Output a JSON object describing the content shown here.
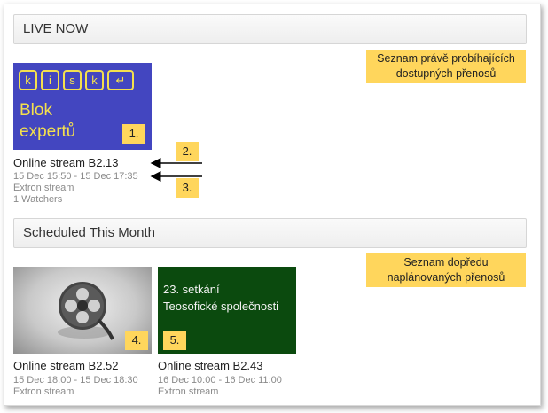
{
  "live": {
    "header": "LIVE NOW",
    "note": [
      "Seznam právě probíhajících",
      "dostupných přenosů"
    ],
    "item": {
      "thumb_keys": [
        "k",
        "i",
        "s",
        "k",
        "↵"
      ],
      "thumb_text": [
        "Blok",
        "expertů"
      ],
      "badge": "1.",
      "title": "Online stream B2.13",
      "time": "15 Dec 15:50 - 15 Dec 17:35",
      "source": "Extron stream",
      "watchers": "1 Watchers"
    },
    "arrow_labels": [
      "2.",
      "3."
    ]
  },
  "scheduled": {
    "header": "Scheduled This Month",
    "note": [
      "Seznam dopředu",
      "naplánovaných přenosů"
    ],
    "items": [
      {
        "badge": "4.",
        "title": "Online stream B2.52",
        "time": "15 Dec 18:00 - 15 Dec 18:30",
        "source": "Extron stream",
        "thumb_icon": "film-reel-icon"
      },
      {
        "badge": "5.",
        "title": "Online stream B2.43",
        "time": "16 Dec 10:00 - 16 Dec 11:00",
        "source": "Extron stream",
        "thumb_text": [
          "23. setkání",
          "Teosofické společnosti"
        ]
      }
    ]
  },
  "colors": {
    "accent_yellow": "#ffd65c",
    "kisk_blue": "#4346c0",
    "kisk_yellow": "#f4e04d",
    "forest_green": "#0b4a0e"
  }
}
